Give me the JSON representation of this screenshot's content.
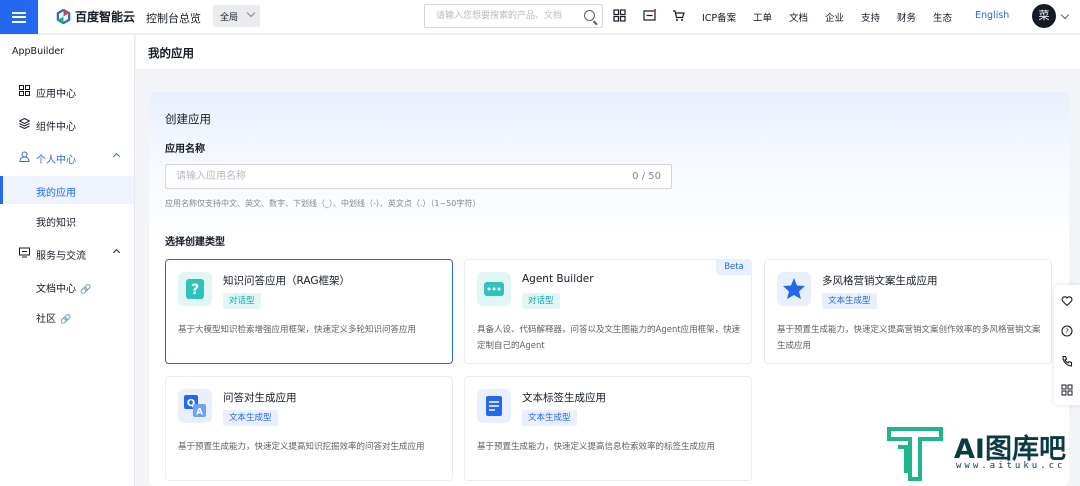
{
  "topbar": {
    "brand": "百度智能云",
    "console": "控制台总览",
    "region": "全局",
    "search_placeholder": "请输入您想要搜索的产品、文档",
    "links": [
      "ICP备案",
      "工单",
      "文档",
      "企业",
      "支持",
      "财务",
      "生态"
    ],
    "language": "English",
    "avatar_initial": "菜"
  },
  "sidebar": {
    "title": "AppBuilder",
    "items": [
      {
        "label": "应用中心",
        "icon": "grid-icon"
      },
      {
        "label": "组件中心",
        "icon": "layers-icon"
      },
      {
        "label": "个人中心",
        "icon": "user-icon"
      },
      {
        "label": "我的应用"
      },
      {
        "label": "我的知识"
      },
      {
        "label": "服务与交流",
        "icon": "chat-icon"
      },
      {
        "label": "文档中心"
      },
      {
        "label": "社区"
      }
    ]
  },
  "page": {
    "title": "我的应用",
    "panel_title": "创建应用",
    "name_label": "应用名称",
    "name_placeholder": "请输入应用名称",
    "name_count": "0 / 50",
    "name_hint": "应用名称仅支持中文、英文、数字、下划线（_）、中划线（-）、英文点（.）（1~50字符）",
    "type_label": "选择创建类型"
  },
  "cards": [
    {
      "title": "知识问答应用（RAG框架）",
      "tag": "对话型",
      "desc": "基于大模型知识检索增强应用框架，快速定义多轮知识问答应用",
      "icon": "question-icon"
    },
    {
      "title": "Agent Builder",
      "tag": "对话型",
      "badge": "Beta",
      "desc": "具备人设、代码解释器，问答以及文生图能力的Agent应用框架，快速定制自己的Agent",
      "icon": "chat-bubble-icon"
    },
    {
      "title": "多风格营销文案生成应用",
      "tag": "文本生成型",
      "desc": "基于预置生成能力，快速定义提高营销文案创作效率的多风格营销文案生成应用",
      "icon": "star-icon"
    },
    {
      "title": "问答对生成应用",
      "tag": "文本生成型",
      "desc": "基于预置生成能力，快速定义提高知识挖掘效率的问答对生成应用",
      "icon": "qa-icon"
    },
    {
      "title": "文本标签生成应用",
      "tag": "文本生成型",
      "desc": "基于预置生成能力，快速定义提高信息检索效率的标签生成应用",
      "icon": "document-icon"
    }
  ],
  "watermark": {
    "text": "AI图库吧",
    "url": "www.aituku.cc"
  },
  "colors": {
    "accent": "#2468f2",
    "chat_tag": "#0fa8a8"
  }
}
